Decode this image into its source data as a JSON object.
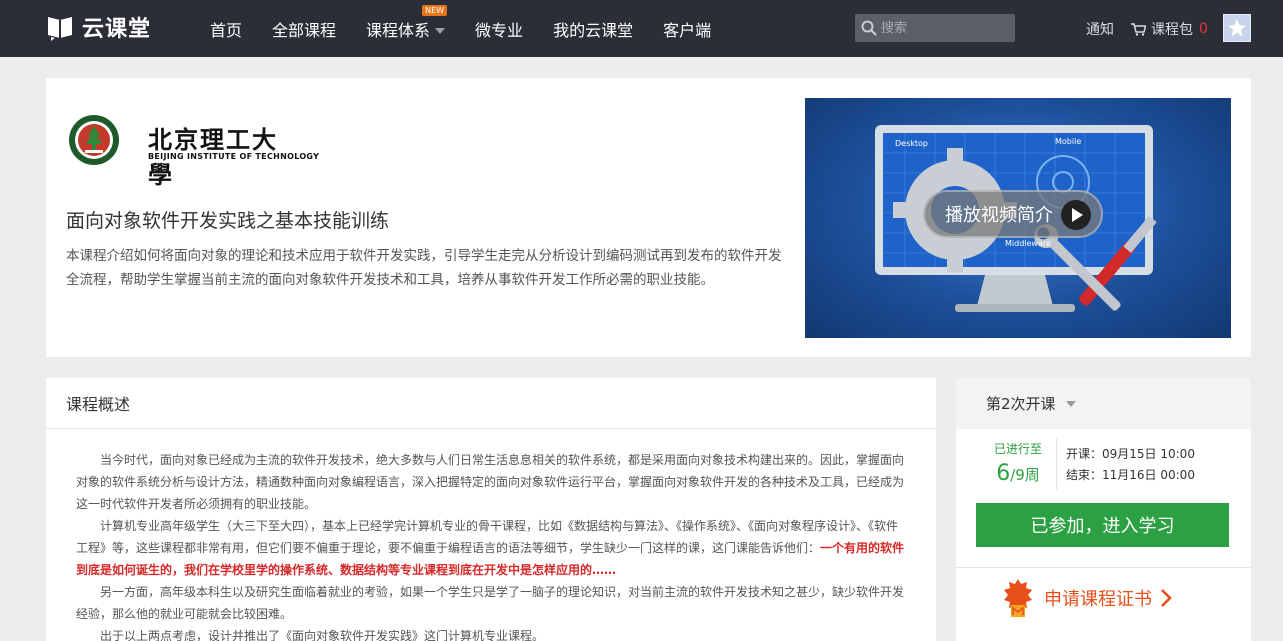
{
  "header": {
    "logo_text": "云课堂",
    "nav": [
      {
        "label": "首页"
      },
      {
        "label": "全部课程"
      },
      {
        "label": "课程体系",
        "badge": "NEW"
      },
      {
        "label": "微专业"
      },
      {
        "label": "我的云课堂"
      },
      {
        "label": "客户端"
      }
    ],
    "search_placeholder": "搜索",
    "notice": "通知",
    "cart_label": "课程包",
    "cart_count": "0"
  },
  "hero": {
    "school_name_cn": "北京理工大學",
    "school_name_en": "BEIJING INSTITUTE OF TECHNOLOGY",
    "course_title": "面向对象软件开发实践之基本技能训练",
    "course_desc": "本课程介绍如何将面向对象的理论和技术应用于软件开发实践，引导学生走完从分析设计到编码测试再到发布的软件开发全流程，帮助学生掌握当前主流的面向对象软件开发技术和工具，培养从事软件开发工作所必需的职业技能。",
    "play_label": "播放视频简介"
  },
  "overview": {
    "title": "课程概述",
    "p1": "当今时代，面向对象已经成为主流的软件开发技术，绝大多数与人们日常生活息息相关的软件系统，都是采用面向对象技术构建出来的。因此，掌握面向对象的软件系统分析与设计方法，精通数种面向对象编程语言，深入把握特定的面向对象软件运行平台，掌握面向对象软件开发的各种技术及工具，已经成为这一时代软件开发者所必须拥有的职业技能。",
    "p2": "计算机专业高年级学生（大三下至大四），基本上已经学完计算机专业的骨干课程，比如《数据结构与算法》、《操作系统》、《面向对象程序设计》、《软件工程》等，这些课程都非常有用，但它们要不偏重于理论，要不偏重于编程语言的语法等细节，学生缺少一门这样的课，这门课能告诉他们：",
    "p2_highlight": "一个有用的软件到底是如何诞生的，我们在学校里学的操作系统、数据结构等专业课程到底在开发中是怎样应用的……",
    "p3": "另一方面，高年级本科生以及研究生面临着就业的考验，如果一个学生只是学了一脑子的理论知识，对当前主流的软件开发技术知之甚少，缺少软件开发经验，那么他的就业可能就会比较困难。",
    "p4": "出于以上两点考虑，设计并推出了《面向对象软件开发实践》这门计算机专业课程。"
  },
  "side": {
    "term": "第2次开课",
    "progress_label": "已进行至",
    "progress_current": "6",
    "progress_total": "/9周",
    "start_label": "开课：",
    "start_date": "09月15日 10:00",
    "end_label": "结束：",
    "end_date": "11月16日 00:00",
    "join_label": "已参加，进入学习",
    "cert_label": "申请课程证书"
  },
  "colors": {
    "topbar": "#2b2e37",
    "green": "#2ca143",
    "orange": "#e8501a",
    "highlight_red": "#d62a2a"
  }
}
